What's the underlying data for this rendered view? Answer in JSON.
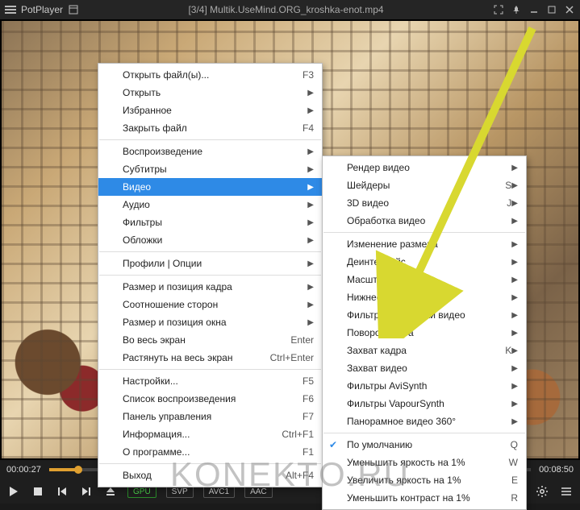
{
  "titlebar": {
    "app_name": "PotPlayer",
    "file_title": "[3/4] Multik.UseMind.ORG_kroshka-enot.mp4"
  },
  "playback": {
    "position": "00:00:27",
    "duration": "00:08:50"
  },
  "status_pills": {
    "gpu": "GPU",
    "svp": "SVP",
    "video_codec": "AVC1",
    "audio_codec": "AAC"
  },
  "menu1": [
    {
      "label": "Открыть файл(ы)...",
      "shortcut": "F3"
    },
    {
      "label": "Открыть",
      "submenu": true
    },
    {
      "label": "Избранное",
      "submenu": true
    },
    {
      "label": "Закрыть файл",
      "shortcut": "F4"
    },
    {
      "sep": true
    },
    {
      "label": "Воспроизведение",
      "submenu": true
    },
    {
      "label": "Субтитры",
      "submenu": true
    },
    {
      "label": "Видео",
      "submenu": true,
      "highlight": true
    },
    {
      "label": "Аудио",
      "submenu": true
    },
    {
      "label": "Фильтры",
      "submenu": true
    },
    {
      "label": "Обложки",
      "submenu": true
    },
    {
      "sep": true
    },
    {
      "label": "Профили | Опции",
      "submenu": true
    },
    {
      "sep": true
    },
    {
      "label": "Размер и позиция кадра",
      "submenu": true
    },
    {
      "label": "Соотношение сторон",
      "submenu": true
    },
    {
      "label": "Размер и позиция окна",
      "submenu": true
    },
    {
      "label": "Во весь экран",
      "shortcut": "Enter"
    },
    {
      "label": "Растянуть на весь экран",
      "shortcut": "Ctrl+Enter"
    },
    {
      "sep": true
    },
    {
      "label": "Настройки...",
      "shortcut": "F5"
    },
    {
      "label": "Список воспроизведения",
      "shortcut": "F6"
    },
    {
      "label": "Панель управления",
      "shortcut": "F7"
    },
    {
      "label": "Информация...",
      "shortcut": "Ctrl+F1"
    },
    {
      "label": "О программе...",
      "shortcut": "F1"
    },
    {
      "sep": true
    },
    {
      "label": "Выход",
      "shortcut": "Alt+F4"
    }
  ],
  "menu2": [
    {
      "label": "Рендер видео",
      "submenu": true
    },
    {
      "label": "Шейдеры",
      "shortcut": "S",
      "submenu": true
    },
    {
      "label": "3D видео",
      "shortcut": "J",
      "submenu": true
    },
    {
      "label": "Обработка видео",
      "submenu": true
    },
    {
      "sep": true
    },
    {
      "label": "Изменение размера",
      "submenu": true
    },
    {
      "label": "Деинтерлейс",
      "submenu": true
    },
    {
      "label": "Масштабирование",
      "submenu": true
    },
    {
      "label": "Нижнее поле экрана",
      "submenu": true
    },
    {
      "label": "Фильтры обработки видео",
      "submenu": true
    },
    {
      "label": "Поворот кадра",
      "submenu": true
    },
    {
      "label": "Захват кадра",
      "shortcut": "K",
      "submenu": true
    },
    {
      "label": "Захват видео",
      "submenu": true
    },
    {
      "label": "Фильтры AviSynth",
      "submenu": true
    },
    {
      "label": "Фильтры VapourSynth",
      "submenu": true
    },
    {
      "label": "Панорамное видео 360°",
      "submenu": true
    },
    {
      "sep": true
    },
    {
      "label": "По умолчанию",
      "shortcut": "Q",
      "checked": true
    },
    {
      "label": "Уменьшить яркость на 1%",
      "shortcut": "W"
    },
    {
      "label": "Увеличить яркость на 1%",
      "shortcut": "E"
    },
    {
      "label": "Уменьшить контраст на 1%",
      "shortcut": "R"
    }
  ],
  "watermark": "KONEKTO.RU"
}
